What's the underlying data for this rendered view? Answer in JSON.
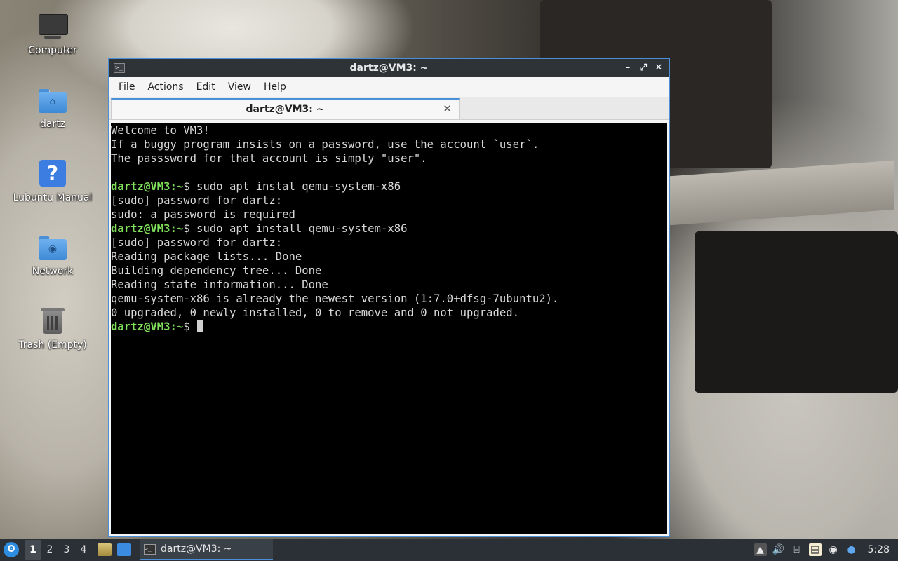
{
  "desktop": {
    "icons": [
      {
        "label": "Computer"
      },
      {
        "label": "dartz"
      },
      {
        "label": "Lubuntu Manual"
      },
      {
        "label": "Network"
      },
      {
        "label": "Trash (Empty)"
      }
    ]
  },
  "window": {
    "title": "dartz@VM3: ~",
    "icon": "terminal-icon",
    "controls": {
      "minimize": "–",
      "maximize": "⤢",
      "close": "✕"
    },
    "menu": [
      "File",
      "Actions",
      "Edit",
      "View",
      "Help"
    ],
    "tab": {
      "label": "dartz@VM3: ~",
      "close": "✕"
    }
  },
  "terminal": {
    "prompt": "dartz@VM3:~",
    "lines": [
      {
        "text": "Welcome to VM3!"
      },
      {
        "text": "If a buggy program insists on a password, use the account `user`."
      },
      {
        "text": "The passsword for that account is simply \"user\"."
      },
      {
        "text": ""
      },
      {
        "prompt": "dartz@VM3:~",
        "text": "$ sudo apt instal qemu-system-x86"
      },
      {
        "text": "[sudo] password for dartz:"
      },
      {
        "text": "sudo: a password is required"
      },
      {
        "prompt": "dartz@VM3:~",
        "text": "$ sudo apt install qemu-system-x86"
      },
      {
        "text": "[sudo] password for dartz:"
      },
      {
        "text": "Reading package lists... Done"
      },
      {
        "text": "Building dependency tree... Done"
      },
      {
        "text": "Reading state information... Done"
      },
      {
        "text": "qemu-system-x86 is already the newest version (1:7.0+dfsg-7ubuntu2)."
      },
      {
        "text": "0 upgraded, 0 newly installed, 0 to remove and 0 not upgraded."
      }
    ],
    "current_prompt": "dartz@VM3:~",
    "current_input": "$ "
  },
  "taskbar": {
    "workspaces": [
      "1",
      "2",
      "3",
      "4"
    ],
    "active_workspace": "1",
    "task": {
      "label": "dartz@VM3: ~"
    },
    "clock": "5:28"
  },
  "colors": {
    "accent": "#4a90d9",
    "prompt_green": "#7fe05a",
    "taskbar_bg": "#2b3036"
  }
}
